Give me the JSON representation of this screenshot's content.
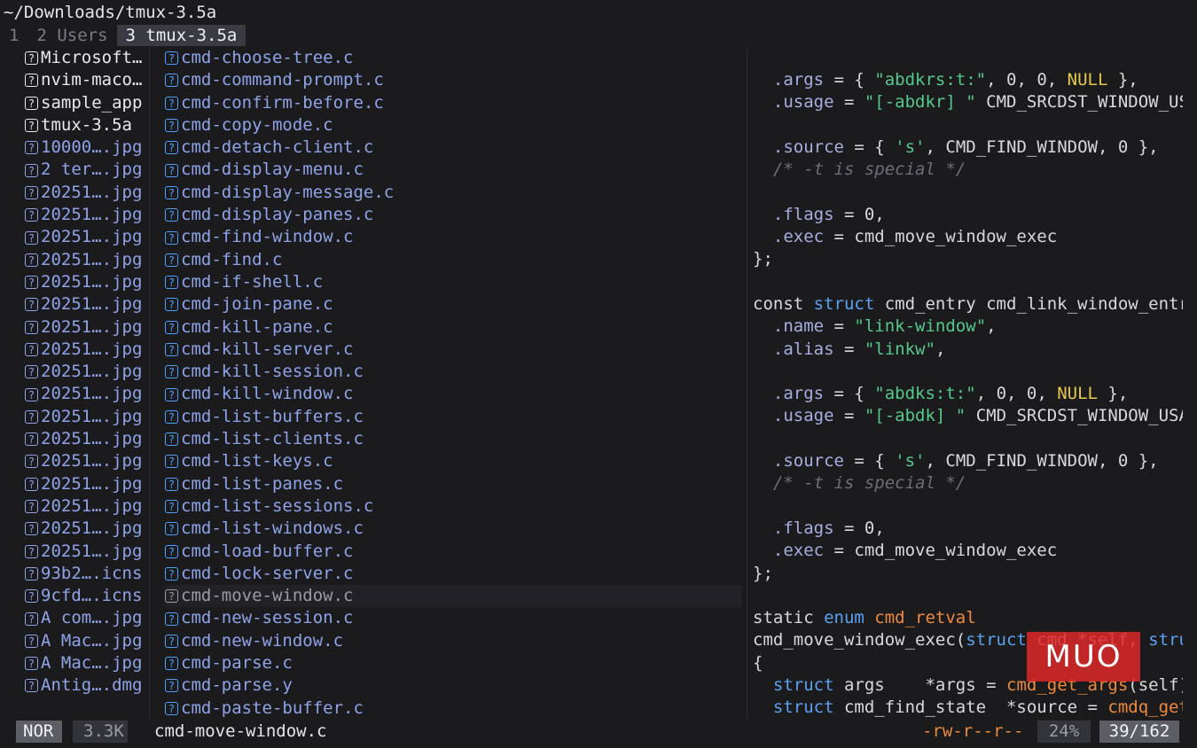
{
  "window": {
    "title": "~/Downloads/tmux-3.5a"
  },
  "tabs": [
    {
      "label": "1",
      "active": false
    },
    {
      "label": "2 Users",
      "active": false
    },
    {
      "label": "3 tmux-3.5a",
      "active": true
    }
  ],
  "parent_list": [
    {
      "name": "Microsoft…",
      "kind": "dir"
    },
    {
      "name": "nvim-maco…",
      "kind": "dir"
    },
    {
      "name": "sample_app",
      "kind": "dir"
    },
    {
      "name": "tmux-3.5a",
      "kind": "dir"
    },
    {
      "name": "10000….jpg",
      "kind": "file"
    },
    {
      "name": "2 ter….jpg",
      "kind": "file"
    },
    {
      "name": "20251….jpg",
      "kind": "file"
    },
    {
      "name": "20251….jpg",
      "kind": "file"
    },
    {
      "name": "20251….jpg",
      "kind": "file"
    },
    {
      "name": "20251….jpg",
      "kind": "file"
    },
    {
      "name": "20251….jpg",
      "kind": "file"
    },
    {
      "name": "20251….jpg",
      "kind": "file"
    },
    {
      "name": "20251….jpg",
      "kind": "file"
    },
    {
      "name": "20251….jpg",
      "kind": "file"
    },
    {
      "name": "20251….jpg",
      "kind": "file"
    },
    {
      "name": "20251….jpg",
      "kind": "file"
    },
    {
      "name": "20251….jpg",
      "kind": "file"
    },
    {
      "name": "20251….jpg",
      "kind": "file"
    },
    {
      "name": "20251….jpg",
      "kind": "file"
    },
    {
      "name": "20251….jpg",
      "kind": "file"
    },
    {
      "name": "20251….jpg",
      "kind": "file"
    },
    {
      "name": "20251….jpg",
      "kind": "file"
    },
    {
      "name": "20251….jpg",
      "kind": "file"
    },
    {
      "name": "93b2….icns",
      "kind": "file"
    },
    {
      "name": "9cfd….icns",
      "kind": "file"
    },
    {
      "name": "A com….jpg",
      "kind": "file"
    },
    {
      "name": "A Mac….jpg",
      "kind": "file"
    },
    {
      "name": "A Mac….jpg",
      "kind": "file"
    },
    {
      "name": "Antig….dmg",
      "kind": "file"
    }
  ],
  "current_list": [
    {
      "name": "cmd-choose-tree.c"
    },
    {
      "name": "cmd-command-prompt.c"
    },
    {
      "name": "cmd-confirm-before.c"
    },
    {
      "name": "cmd-copy-mode.c"
    },
    {
      "name": "cmd-detach-client.c"
    },
    {
      "name": "cmd-display-menu.c"
    },
    {
      "name": "cmd-display-message.c"
    },
    {
      "name": "cmd-display-panes.c"
    },
    {
      "name": "cmd-find-window.c"
    },
    {
      "name": "cmd-find.c"
    },
    {
      "name": "cmd-if-shell.c"
    },
    {
      "name": "cmd-join-pane.c"
    },
    {
      "name": "cmd-kill-pane.c"
    },
    {
      "name": "cmd-kill-server.c"
    },
    {
      "name": "cmd-kill-session.c"
    },
    {
      "name": "cmd-kill-window.c"
    },
    {
      "name": "cmd-list-buffers.c"
    },
    {
      "name": "cmd-list-clients.c"
    },
    {
      "name": "cmd-list-keys.c"
    },
    {
      "name": "cmd-list-panes.c"
    },
    {
      "name": "cmd-list-sessions.c"
    },
    {
      "name": "cmd-list-windows.c"
    },
    {
      "name": "cmd-load-buffer.c"
    },
    {
      "name": "cmd-lock-server.c"
    },
    {
      "name": "cmd-move-window.c",
      "selected": true
    },
    {
      "name": "cmd-new-session.c"
    },
    {
      "name": "cmd-new-window.c"
    },
    {
      "name": "cmd-parse.c"
    },
    {
      "name": "cmd-parse.y"
    },
    {
      "name": "cmd-paste-buffer.c"
    }
  ],
  "preview": {
    "lines": [
      [
        [
          "  ",
          "p"
        ],
        [
          ".args",
          "n"
        ],
        [
          " = { ",
          "p"
        ],
        [
          "\"abdkrs:t:\"",
          "s"
        ],
        [
          ", 0, 0, ",
          "p"
        ],
        [
          "NULL",
          "y"
        ],
        [
          " },",
          "p"
        ]
      ],
      [
        [
          "  ",
          "p"
        ],
        [
          ".usage",
          "n"
        ],
        [
          " = ",
          "p"
        ],
        [
          "\"[-abdkr] \"",
          "s"
        ],
        [
          " CMD_SRCDST_WINDOW_US",
          "p"
        ]
      ],
      [],
      [
        [
          "  ",
          "p"
        ],
        [
          ".source",
          "n"
        ],
        [
          " = { ",
          "p"
        ],
        [
          "'s'",
          "s"
        ],
        [
          ", CMD_FIND_WINDOW, 0 },",
          "p"
        ]
      ],
      [
        [
          "  ",
          "p"
        ],
        [
          "/* -t is special */",
          "c"
        ]
      ],
      [],
      [
        [
          "  ",
          "p"
        ],
        [
          ".flags",
          "n"
        ],
        [
          " = 0,",
          "p"
        ]
      ],
      [
        [
          "  ",
          "p"
        ],
        [
          ".exec",
          "n"
        ],
        [
          " = cmd_move_window_exec",
          "p"
        ]
      ],
      [
        [
          "};",
          "p"
        ]
      ],
      [],
      [
        [
          "const ",
          "p"
        ],
        [
          "struct",
          "k"
        ],
        [
          " cmd_entry cmd_link_window_entr",
          "p"
        ]
      ],
      [
        [
          "  ",
          "p"
        ],
        [
          ".name",
          "n"
        ],
        [
          " = ",
          "p"
        ],
        [
          "\"link-window\"",
          "s"
        ],
        [
          ",",
          "p"
        ]
      ],
      [
        [
          "  ",
          "p"
        ],
        [
          ".alias",
          "n"
        ],
        [
          " = ",
          "p"
        ],
        [
          "\"linkw\"",
          "s"
        ],
        [
          ",",
          "p"
        ]
      ],
      [],
      [
        [
          "  ",
          "p"
        ],
        [
          ".args",
          "n"
        ],
        [
          " = { ",
          "p"
        ],
        [
          "\"abdks:t:\"",
          "s"
        ],
        [
          ", 0, 0, ",
          "p"
        ],
        [
          "NULL",
          "y"
        ],
        [
          " },",
          "p"
        ]
      ],
      [
        [
          "  ",
          "p"
        ],
        [
          ".usage",
          "n"
        ],
        [
          " = ",
          "p"
        ],
        [
          "\"[-abdk] \"",
          "s"
        ],
        [
          " CMD_SRCDST_WINDOW_USA",
          "p"
        ]
      ],
      [],
      [
        [
          "  ",
          "p"
        ],
        [
          ".source",
          "n"
        ],
        [
          " = { ",
          "p"
        ],
        [
          "'s'",
          "s"
        ],
        [
          ", CMD_FIND_WINDOW, 0 },",
          "p"
        ]
      ],
      [
        [
          "  ",
          "p"
        ],
        [
          "/* -t is special */",
          "c"
        ]
      ],
      [],
      [
        [
          "  ",
          "p"
        ],
        [
          ".flags",
          "n"
        ],
        [
          " = 0,",
          "p"
        ]
      ],
      [
        [
          "  ",
          "p"
        ],
        [
          ".exec",
          "n"
        ],
        [
          " = cmd_move_window_exec",
          "p"
        ]
      ],
      [
        [
          "};",
          "p"
        ]
      ],
      [],
      [
        [
          "static ",
          "p"
        ],
        [
          "enum",
          "k"
        ],
        [
          " ",
          "p"
        ],
        [
          "cmd_retval",
          "o"
        ]
      ],
      [
        [
          "cmd_move_window_exec(",
          "p"
        ],
        [
          "struct",
          "k"
        ],
        [
          " cmd *self, ",
          "p"
        ],
        [
          "stru",
          "k"
        ]
      ],
      [
        [
          "{",
          "p"
        ]
      ],
      [
        [
          "  ",
          "p"
        ],
        [
          "struct",
          "k"
        ],
        [
          " args    *args = ",
          "p"
        ],
        [
          "cmd_get_args",
          "o"
        ],
        [
          "(self)",
          "p"
        ]
      ],
      [
        [
          "  ",
          "p"
        ],
        [
          "struct",
          "k"
        ],
        [
          " cmd_find_state  *source = ",
          "p"
        ],
        [
          "cmdq_get",
          "o"
        ]
      ]
    ]
  },
  "status": {
    "mode": "NOR",
    "size": "3.3K",
    "filename": "cmd-move-window.c",
    "permissions": "-rw-r--r--",
    "percent": "24%",
    "position": "39/162"
  },
  "watermark": {
    "text": "MUO"
  },
  "colors": {
    "keyword": "#5aa2ef",
    "string": "#55c98b",
    "field": "#a7aee0",
    "null": "#e6c84a",
    "function": "#ee8a3c",
    "comment": "#6d6e78"
  }
}
